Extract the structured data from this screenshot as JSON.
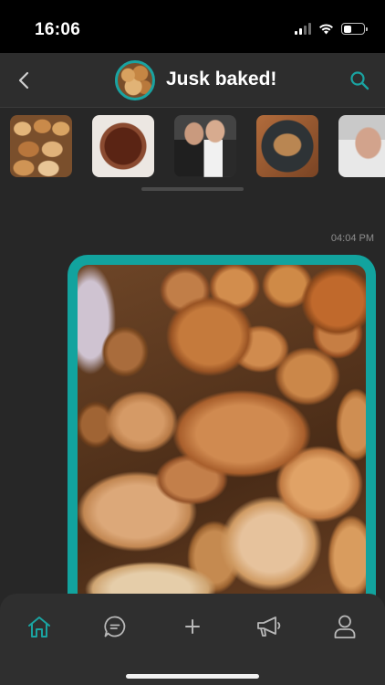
{
  "status_bar": {
    "time": "16:06",
    "signal_bars_active": 2,
    "signal_bars_total": 4,
    "battery_level": 0.35
  },
  "header": {
    "title": "Jusk baked!",
    "back_icon": "chevron-left-icon",
    "search_icon": "search-icon",
    "avatar": "group-avatar"
  },
  "media_strip": {
    "thumbnails": [
      "bread-rolls-thumbnail",
      "chocolate-bowl-thumbnail",
      "people-photo-thumbnail",
      "loaf-on-plate-thumbnail",
      "man-portrait-thumbnail"
    ]
  },
  "message": {
    "time": "04:04 PM",
    "image": "bread-rolls-photo"
  },
  "bottom_nav": {
    "items": [
      {
        "icon": "home-icon",
        "active": true
      },
      {
        "icon": "chat-icon",
        "active": false
      },
      {
        "icon": "plus-icon",
        "active": false
      },
      {
        "icon": "megaphone-icon",
        "active": false
      },
      {
        "icon": "profile-icon",
        "active": false
      }
    ]
  },
  "colors": {
    "accent": "#12a39e",
    "background": "#272727",
    "header": "#2d2d2d",
    "nav": "#2f2f2f"
  }
}
